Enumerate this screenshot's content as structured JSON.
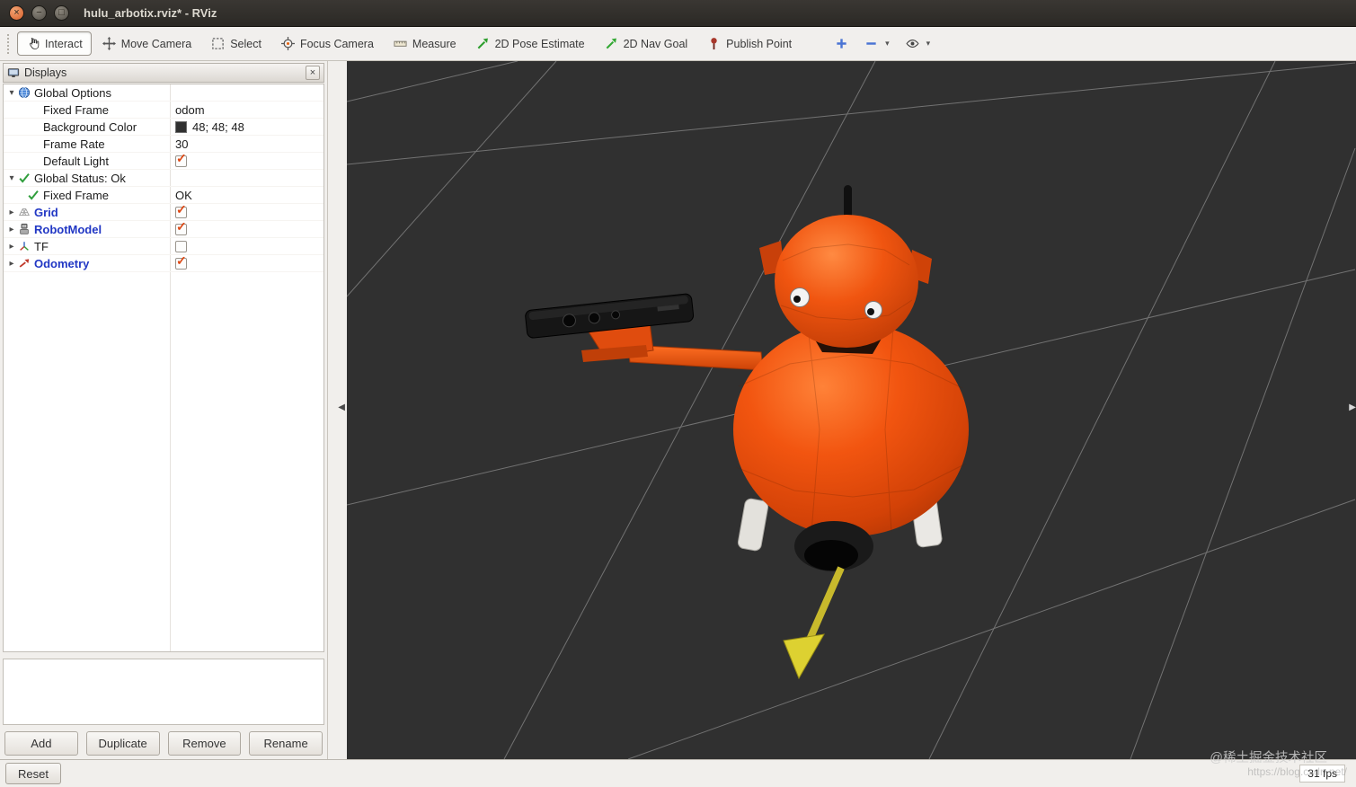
{
  "window": {
    "title": "hulu_arbotix.rviz* - RViz",
    "controls": {
      "close": "×",
      "minimize": "−",
      "maximize": "□"
    }
  },
  "toolbar": {
    "tools": [
      {
        "label": "Interact",
        "icon": "interact-hand-icon",
        "active": true
      },
      {
        "label": "Move Camera",
        "icon": "move-camera-icon",
        "active": false
      },
      {
        "label": "Select",
        "icon": "select-icon",
        "active": false
      },
      {
        "label": "Focus Camera",
        "icon": "focus-camera-icon",
        "active": false
      },
      {
        "label": "Measure",
        "icon": "measure-icon",
        "active": false
      },
      {
        "label": "2D Pose Estimate",
        "icon": "pose-estimate-icon",
        "active": false
      },
      {
        "label": "2D Nav Goal",
        "icon": "nav-goal-icon",
        "active": false
      },
      {
        "label": "Publish Point",
        "icon": "publish-point-icon",
        "active": false
      }
    ],
    "extra_tools": [
      {
        "name": "add-tool-button",
        "icon": "plus-icon",
        "dropdown": false
      },
      {
        "name": "remove-tool-button",
        "icon": "minus-icon",
        "dropdown": true
      },
      {
        "name": "tool-visibility-button",
        "icon": "eye-icon",
        "dropdown": true
      }
    ]
  },
  "displays_panel": {
    "title": "Displays",
    "rows": [
      {
        "level": 0,
        "expander": "open",
        "icon": "globe-icon",
        "name": "Global Options",
        "value": "",
        "value_type": "none",
        "bold": false
      },
      {
        "level": 1,
        "expander": "none",
        "icon": "",
        "name": "Fixed Frame",
        "value": "odom",
        "value_type": "text",
        "bold": false
      },
      {
        "level": 1,
        "expander": "none",
        "icon": "",
        "name": "Background Color",
        "value": "48; 48; 48",
        "value_type": "color",
        "swatch": "#303030",
        "bold": false
      },
      {
        "level": 1,
        "expander": "none",
        "icon": "",
        "name": "Frame Rate",
        "value": "30",
        "value_type": "text",
        "bold": false
      },
      {
        "level": 1,
        "expander": "none",
        "icon": "",
        "name": "Default Light",
        "value": "",
        "value_type": "checkbox",
        "checked": true,
        "bold": false
      },
      {
        "level": 0,
        "expander": "open",
        "icon": "check-icon",
        "name": "Global Status: Ok",
        "value": "",
        "value_type": "none",
        "bold": false
      },
      {
        "level": 1,
        "expander": "none",
        "icon": "check-icon",
        "name": "Fixed Frame",
        "value": "OK",
        "value_type": "text",
        "bold": false
      },
      {
        "level": 0,
        "expander": "closed",
        "icon": "grid-icon",
        "name": "Grid",
        "value": "",
        "value_type": "checkbox",
        "checked": true,
        "bold": true
      },
      {
        "level": 0,
        "expander": "closed",
        "icon": "robot-icon",
        "name": "RobotModel",
        "value": "",
        "value_type": "checkbox",
        "checked": true,
        "bold": true
      },
      {
        "level": 0,
        "expander": "closed",
        "icon": "tf-icon",
        "name": "TF",
        "value": "",
        "value_type": "checkbox",
        "checked": false,
        "bold": false
      },
      {
        "level": 0,
        "expander": "closed",
        "icon": "odometry-icon",
        "name": "Odometry",
        "value": "",
        "value_type": "checkbox",
        "checked": true,
        "bold": true
      }
    ],
    "buttons": [
      {
        "label": "Add",
        "name": "add-display-button"
      },
      {
        "label": "Duplicate",
        "name": "duplicate-display-button"
      },
      {
        "label": "Remove",
        "name": "remove-display-button"
      },
      {
        "label": "Rename",
        "name": "rename-display-button"
      }
    ]
  },
  "time_panel": {
    "reset_label": "Reset",
    "fps": "31 fps"
  },
  "viewport": {
    "background_color": "#303030",
    "robot_color": "#ee4d0f",
    "odometry_arrow_color": "#d8ca2e",
    "grid_line_color": "#8e8e8e",
    "watermark_community": "@稀土掘金技术社区",
    "watermark_url": "https://blog.csdn.net/"
  }
}
